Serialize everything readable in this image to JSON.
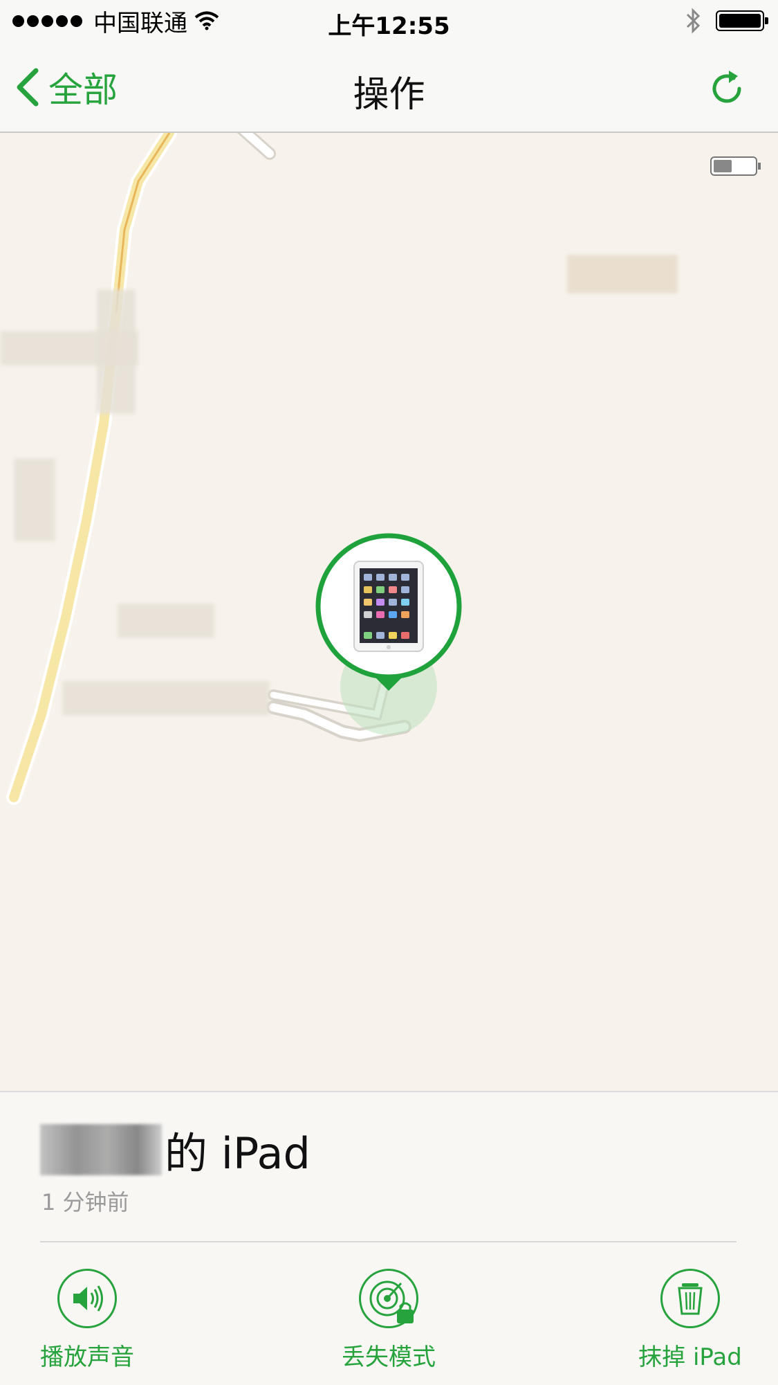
{
  "status_bar": {
    "carrier": "中国联通",
    "time": "上午12:55"
  },
  "nav": {
    "back_label": "全部",
    "title": "操作"
  },
  "device": {
    "name_suffix": "的 iPad",
    "last_seen": "1 分钟前"
  },
  "actions": [
    {
      "label": "播放声音",
      "icon": "speaker-icon"
    },
    {
      "label": "丢失模式",
      "icon": "radar-lock-icon"
    },
    {
      "label": "抹掉 iPad",
      "icon": "trash-icon"
    }
  ],
  "colors": {
    "accent": "#27a33d",
    "map_background": "#f7f3ec"
  }
}
